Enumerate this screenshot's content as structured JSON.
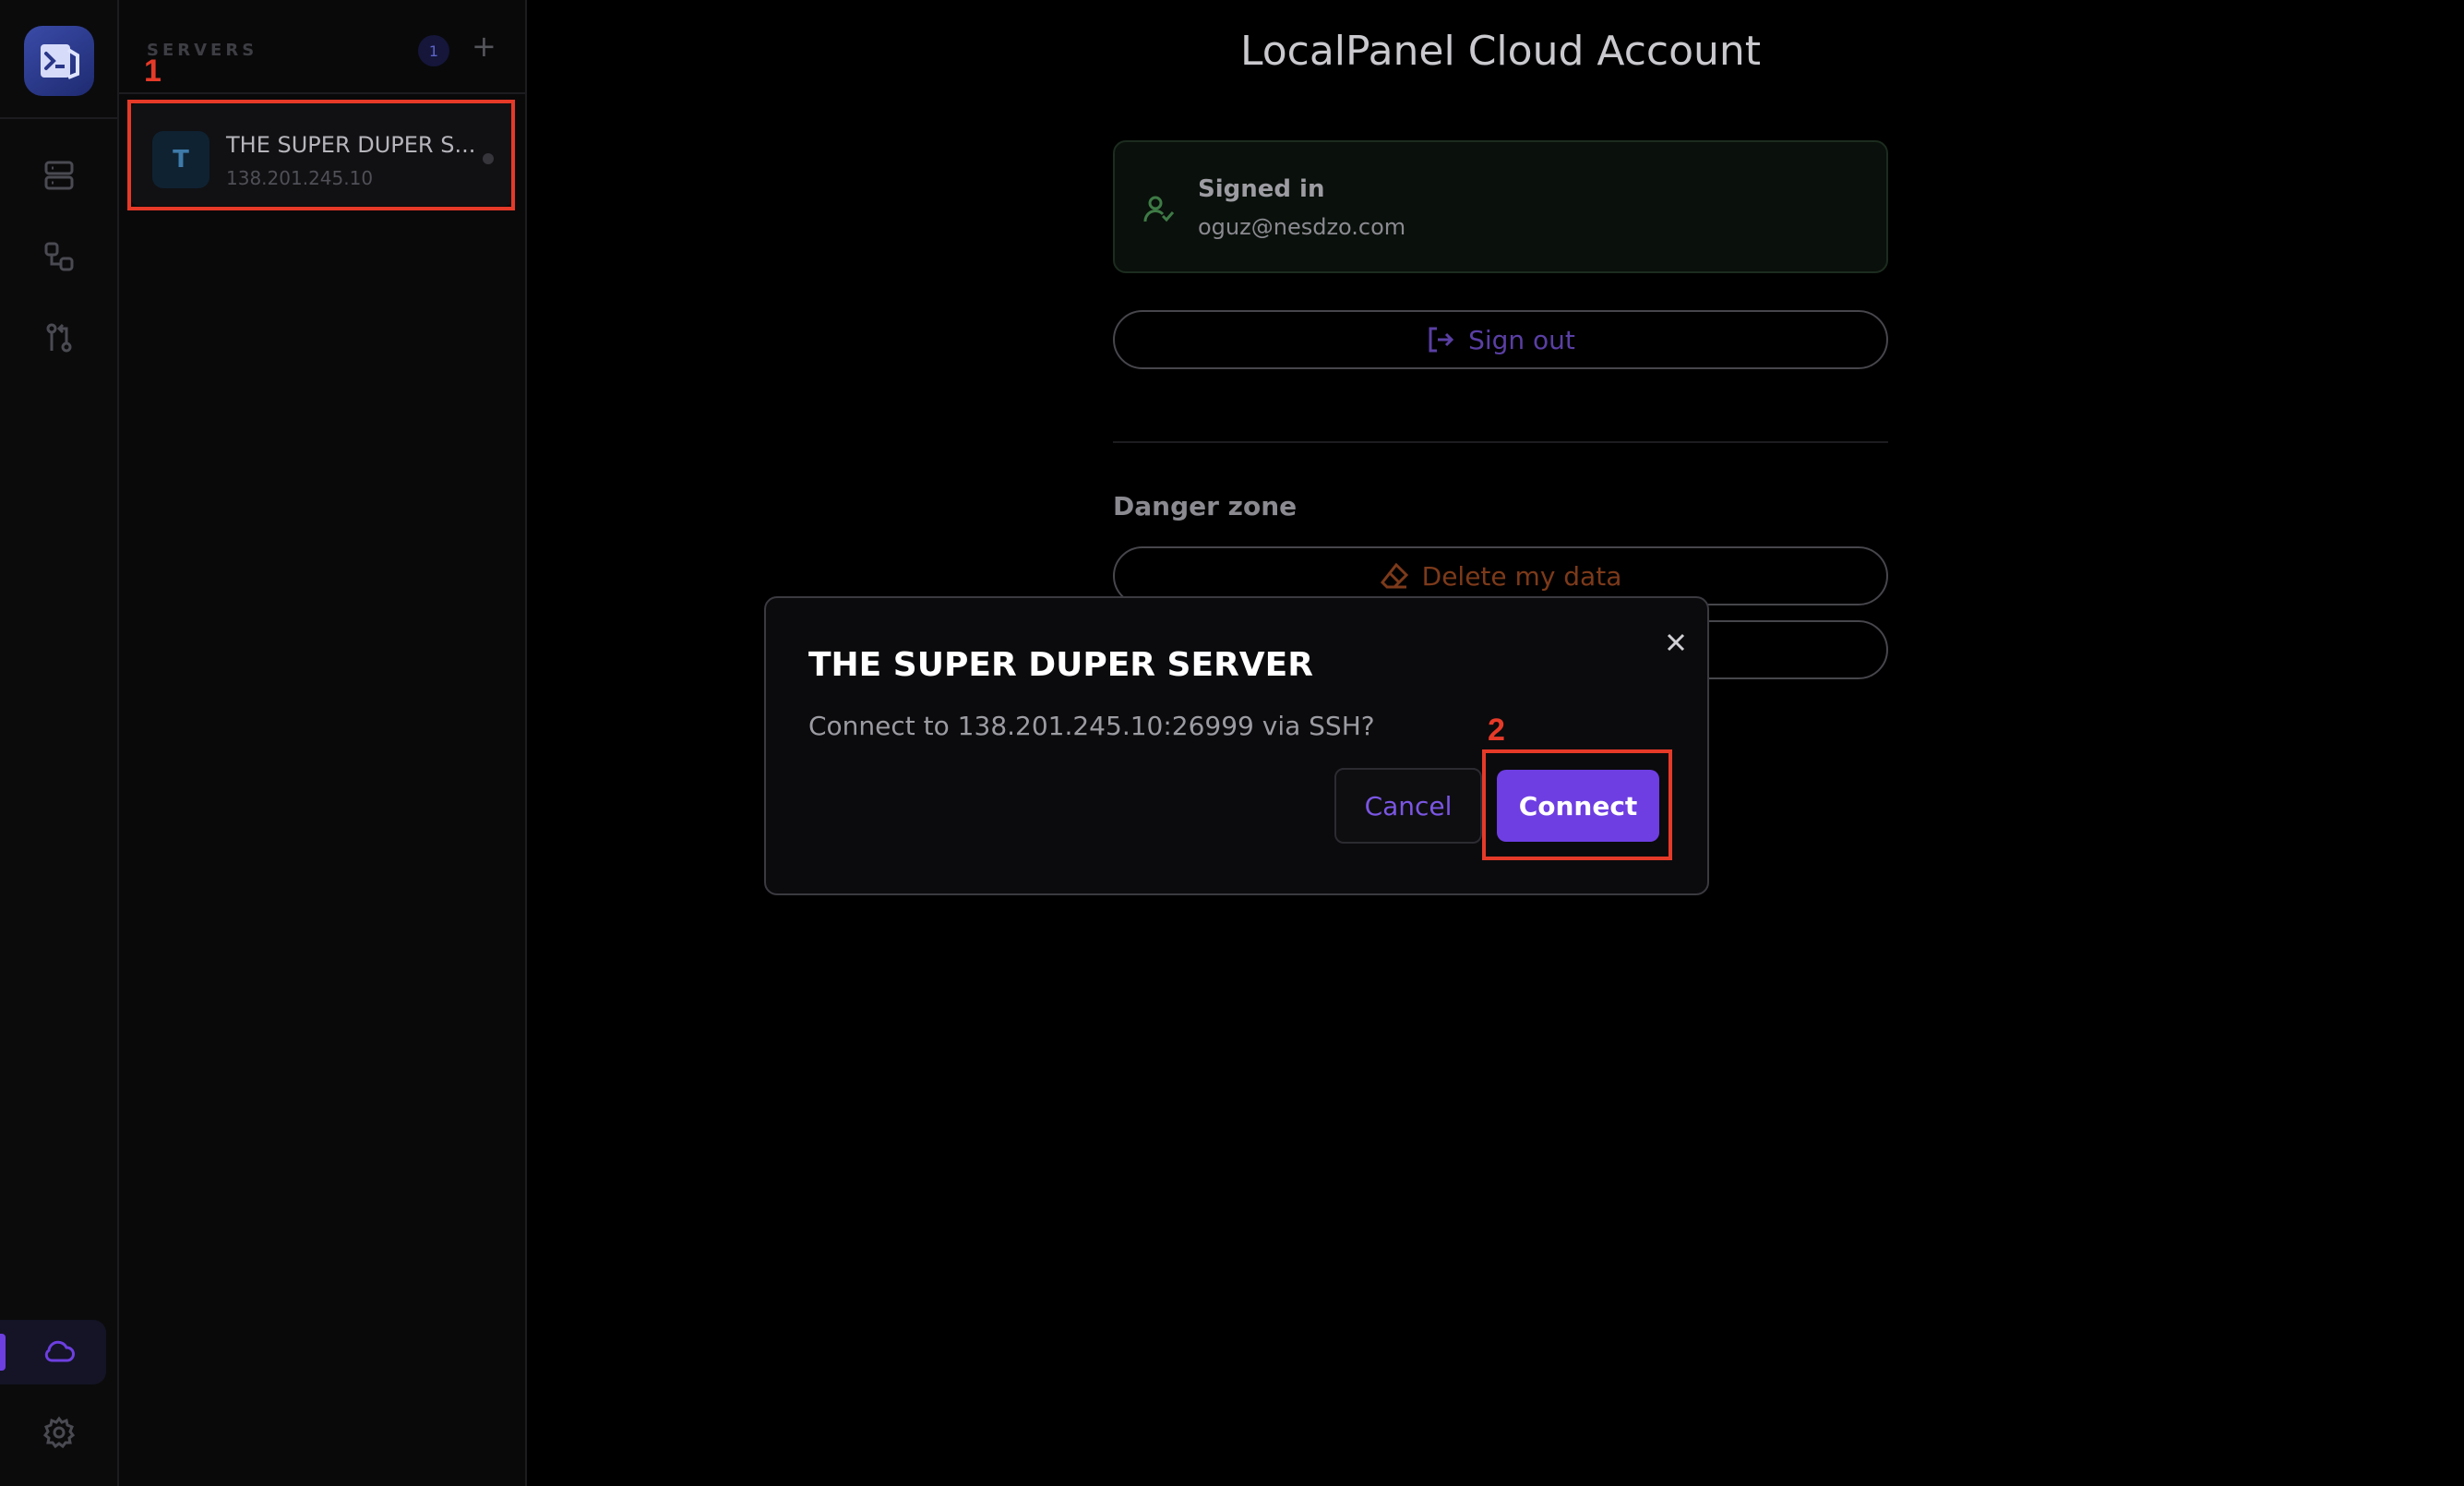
{
  "rail": {
    "items": [
      "servers-icon",
      "connections-icon",
      "sync-icon",
      "cloud-icon",
      "settings-icon"
    ],
    "active": "cloud-icon",
    "accent": "#6d3fe0"
  },
  "servers": {
    "title": "SERVERS",
    "count": "1",
    "add_label": "+",
    "items": [
      {
        "initial": "T",
        "name": "THE SUPER DUPER S...",
        "ip": "138.201.245.10"
      }
    ]
  },
  "annotations": {
    "first": "1",
    "second": "2",
    "color": "#e63a28"
  },
  "account": {
    "title": "LocalPanel Cloud Account",
    "signed_in_label": "Signed in",
    "email": "oguz@nesdzo.com",
    "sign_out_label": "Sign out",
    "danger_zone_title": "Danger zone",
    "delete_label": "Delete my data"
  },
  "dialog": {
    "title": "THE SUPER DUPER SERVER",
    "message": "Connect to 138.201.245.10:26999 via SSH?",
    "cancel_label": "Cancel",
    "connect_label": "Connect",
    "primary_color": "#6e3ee2"
  }
}
